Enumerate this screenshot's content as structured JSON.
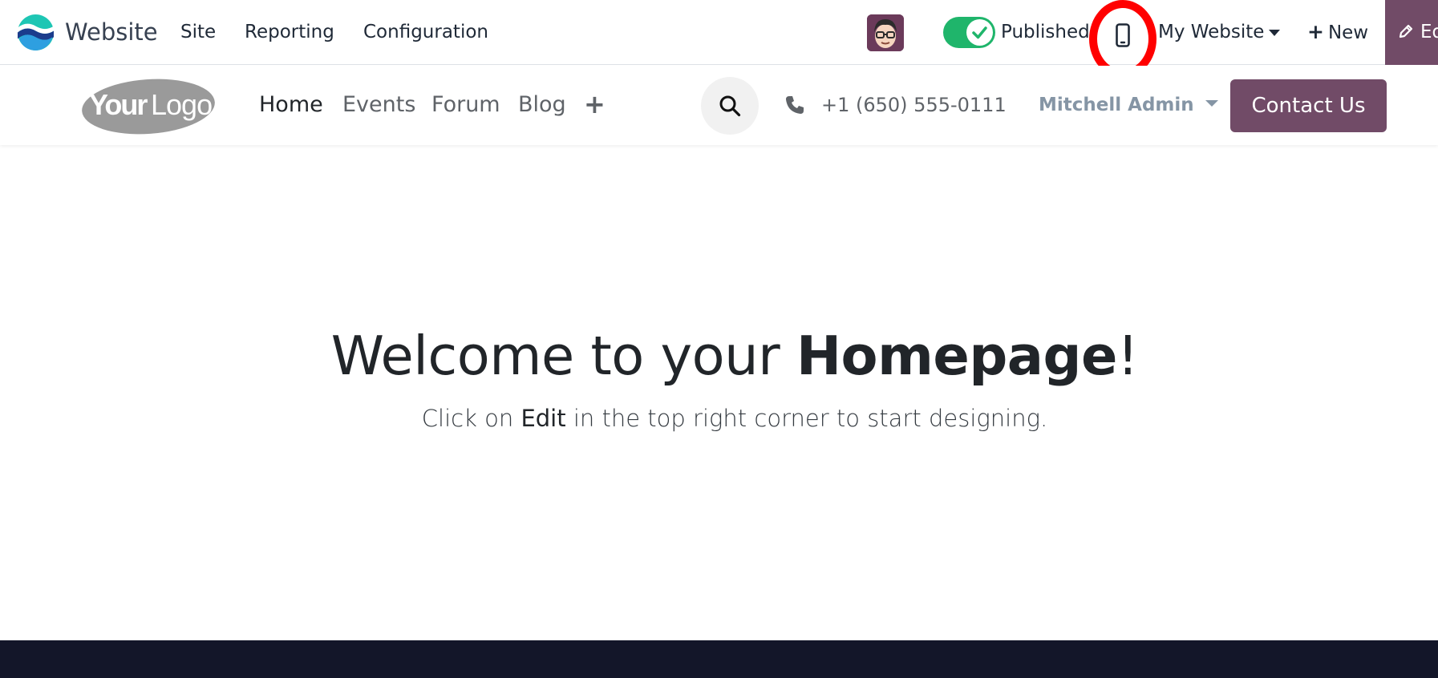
{
  "topbar": {
    "app_name": "Website",
    "menu": [
      "Site",
      "Reporting",
      "Configuration"
    ],
    "published_label": "Published",
    "published_on": true,
    "website_switcher": "My Website",
    "new_label": "New",
    "edit_label": "Edit",
    "edit_visible": "Ed",
    "accent": "#714b67",
    "toggle_color": "#1fb56b",
    "highlight_color": "#ff0000"
  },
  "sitenav": {
    "logo_text": "YourLogo",
    "links": [
      "Home",
      "Events",
      "Forum",
      "Blog"
    ],
    "active_link": "Home",
    "add_icon": "plus-icon",
    "phone": "+1 (650) 555-0111",
    "user": "Mitchell Admin",
    "contact_label": "Contact Us"
  },
  "hero": {
    "title_prefix": "Welcome to your ",
    "title_bold": "Homepage",
    "title_suffix": "!",
    "sub_prefix": "Click on ",
    "sub_bold": "Edit",
    "sub_suffix": " in the top right corner to start designing."
  },
  "footer": {
    "color": "#131629"
  }
}
